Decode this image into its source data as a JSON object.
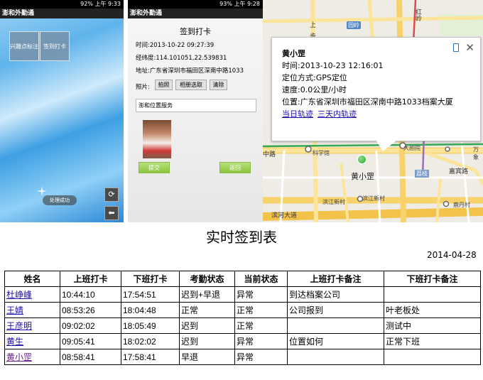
{
  "panel1": {
    "status_right": "92% 上午 9:33",
    "app_title": "澎和外勤通",
    "tiles": [
      "兴趣点标注",
      "签到打卡"
    ],
    "toast": "处理成功",
    "side_buttons": [
      {
        "icon": "refresh-icon",
        "glyph": "⟳"
      },
      {
        "icon": "back-icon",
        "glyph": "⬅"
      }
    ]
  },
  "panel2": {
    "status_right": "93% 上午 9:28",
    "app_title": "澎和外勤通",
    "heading": "签到打卡",
    "time_line": "时间:2013-10-22 09:27:39",
    "coord_line": "经纬度:114.101051,22.539831",
    "address_line": "地址:广东省深圳市福田区深南中路1033",
    "photo_label": "照片:",
    "buttons": [
      "拍照",
      "相册选取",
      "清除"
    ],
    "location_input": "澎和位置服务",
    "submit_label": "提交",
    "return_label": "返回"
  },
  "panel3": {
    "popup": {
      "name": "黄小罡",
      "time": "时间:2013-10-23 12:16:01",
      "method": "定位方式:GPS定位",
      "speed": "速度:0.0公里/小时",
      "position": "位置:广东省深圳市福田区深南中路1033档案大厦",
      "link_today": "当日轨迹",
      "link_3days": "三天内轨迹"
    },
    "marker_label": "黄小罡",
    "map_labels": {
      "shang": "上",
      "bu": "步",
      "honglingtop": "红岭",
      "yuanling": "园岭",
      "road_middle": "中路",
      "kexueguan": "科学馆",
      "dajuyuan": "大剧院",
      "wan": "万象",
      "lizhi": "荔枝",
      "jiabin": "嘉宾路",
      "jiangbei": "滨江新村",
      "binhe": "滨河大道",
      "huangtian": "黄田",
      "binjiang": "滨江新村",
      "luohu": "鹿丹村"
    }
  },
  "report": {
    "title": "实时签到表",
    "date": "2014-04-28",
    "headers": [
      "姓名",
      "上班打卡",
      "下班打卡",
      "考勤状态",
      "当前状态",
      "上班打卡备注",
      "下班打卡备注"
    ],
    "rows": [
      {
        "name": "杜峥峰",
        "in": "10:44:10",
        "out": "17:54:51",
        "attendance": "迟到+早退",
        "current": "异常",
        "in_note": "到达档案公司",
        "out_note": ""
      },
      {
        "name": "王婧",
        "in": "08:53:26",
        "out": "18:04:48",
        "attendance": "正常",
        "current": "正常",
        "in_note": "公司报到",
        "out_note": "叶老板处"
      },
      {
        "name": "王彦明",
        "in": "09:02:02",
        "out": "18:05:49",
        "attendance": "迟到",
        "current": "正常",
        "in_note": "",
        "out_note": "测试中"
      },
      {
        "name": "黄生",
        "in": "09:05:41",
        "out": "18:02:02",
        "attendance": "迟到",
        "current": "异常",
        "in_note": "位置如何",
        "out_note": "正常下班"
      },
      {
        "name": "黄小罡",
        "in": "08:58:41",
        "out": "17:58:41",
        "attendance": "早退",
        "current": "异常",
        "in_note": "",
        "out_note": ""
      }
    ]
  }
}
